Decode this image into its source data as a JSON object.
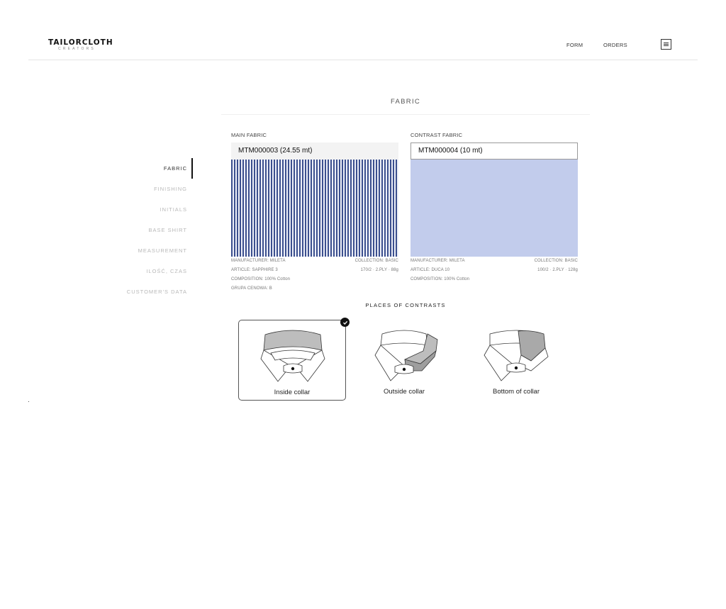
{
  "brand": {
    "name": "TAILORCLOTH",
    "tagline": "CREATORS"
  },
  "header": {
    "nav": [
      {
        "label": "FORM"
      },
      {
        "label": "ORDERS"
      }
    ]
  },
  "section": {
    "title": "FABRIC"
  },
  "sidebar": {
    "items": [
      {
        "label": "FABRIC",
        "active": true
      },
      {
        "label": "FINISHING"
      },
      {
        "label": "INITIALS"
      },
      {
        "label": "BASE SHIRT"
      },
      {
        "label": "MEASUREMENT"
      },
      {
        "label": "ILOŚĆ, CZAS"
      },
      {
        "label": "CUSTOMER'S DATA"
      }
    ]
  },
  "main_fabric": {
    "label": "MAIN FABRIC",
    "value": "MTM000003 (24.55 mt)",
    "manufacturer": "MANUFACTURER: MILETA",
    "collection": "COLLECTION: BASIC",
    "article": "ARTICLE: SAPPHIRE 3",
    "spec": "170/2 · 2.PLY · 88g",
    "composition": "COMPOSITION: 100% Cotton",
    "price_group": "GRUPA CENOWA: B"
  },
  "contrast_fabric": {
    "label": "CONTRAST FABRIC",
    "value": "MTM000004 (10 mt)",
    "manufacturer": "MANUFACTURER: MILETA",
    "collection": "COLLECTION: BASIC",
    "article": "ARTICLE: DUCA 10",
    "spec": "100/2 · 2.PLY · 128g",
    "composition": "COMPOSITION: 100% Cotton"
  },
  "places": {
    "title": "PLACES OF CONTRASTS",
    "options": [
      {
        "label": "Inside collar",
        "selected": true,
        "icon": "inside-collar-icon"
      },
      {
        "label": "Outside collar",
        "selected": false,
        "icon": "outside-collar-icon"
      },
      {
        "label": "Bottom of collar",
        "selected": false,
        "icon": "bottom-collar-icon"
      }
    ]
  },
  "colors": {
    "stripe_navy": "#3b4f8e",
    "contrast_blue": "#c2ccec",
    "highlight_grey": "#bdbdbd"
  }
}
